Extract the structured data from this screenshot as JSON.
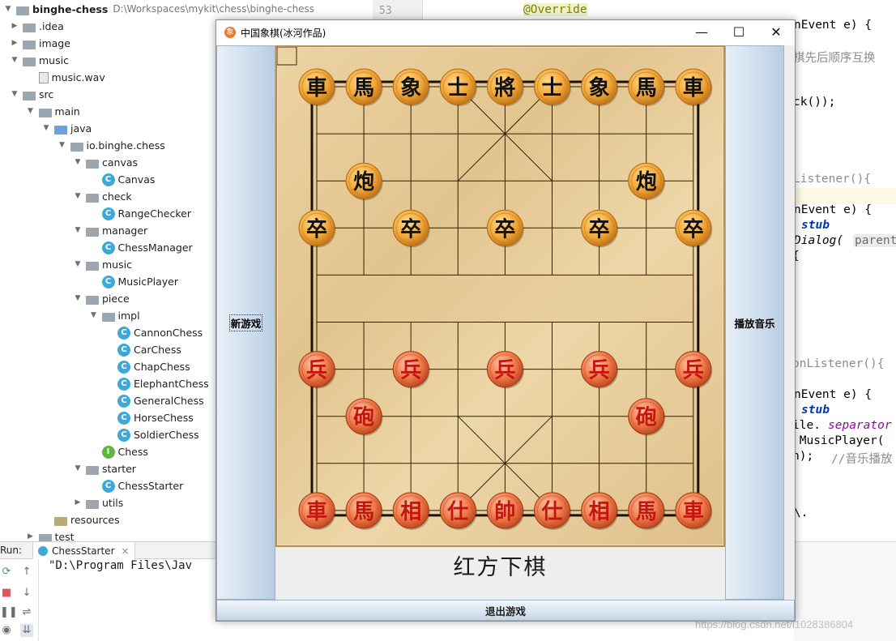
{
  "ide": {
    "project_root": {
      "name": "binghe-chess",
      "path": "D:\\Workspaces\\mykit\\chess\\binghe-chess"
    },
    "tree": [
      {
        "label": ".idea",
        "depth": 1,
        "kind": "folder",
        "arrow": "right"
      },
      {
        "label": "image",
        "depth": 1,
        "kind": "folder",
        "arrow": "right"
      },
      {
        "label": "music",
        "depth": 1,
        "kind": "folder",
        "arrow": "down"
      },
      {
        "label": "music.wav",
        "depth": 2,
        "kind": "file",
        "arrow": ""
      },
      {
        "label": "src",
        "depth": 1,
        "kind": "folder",
        "arrow": "down"
      },
      {
        "label": "main",
        "depth": 2,
        "kind": "folder",
        "arrow": "down"
      },
      {
        "label": "java",
        "depth": 3,
        "kind": "folder-blue",
        "arrow": "down"
      },
      {
        "label": "io.binghe.chess",
        "depth": 4,
        "kind": "folder",
        "arrow": "down"
      },
      {
        "label": "canvas",
        "depth": 5,
        "kind": "folder",
        "arrow": "down"
      },
      {
        "label": "Canvas",
        "depth": 6,
        "kind": "class",
        "arrow": ""
      },
      {
        "label": "check",
        "depth": 5,
        "kind": "folder",
        "arrow": "down"
      },
      {
        "label": "RangeChecker",
        "depth": 6,
        "kind": "class",
        "arrow": ""
      },
      {
        "label": "manager",
        "depth": 5,
        "kind": "folder",
        "arrow": "down"
      },
      {
        "label": "ChessManager",
        "depth": 6,
        "kind": "class",
        "arrow": ""
      },
      {
        "label": "music",
        "depth": 5,
        "kind": "folder",
        "arrow": "down"
      },
      {
        "label": "MusicPlayer",
        "depth": 6,
        "kind": "class",
        "arrow": ""
      },
      {
        "label": "piece",
        "depth": 5,
        "kind": "folder",
        "arrow": "down"
      },
      {
        "label": "impl",
        "depth": 6,
        "kind": "folder",
        "arrow": "down"
      },
      {
        "label": "CannonChess",
        "depth": 7,
        "kind": "class",
        "arrow": ""
      },
      {
        "label": "CarChess",
        "depth": 7,
        "kind": "class",
        "arrow": ""
      },
      {
        "label": "ChapChess",
        "depth": 7,
        "kind": "class",
        "arrow": ""
      },
      {
        "label": "ElephantChess",
        "depth": 7,
        "kind": "class",
        "arrow": ""
      },
      {
        "label": "GeneralChess",
        "depth": 7,
        "kind": "class",
        "arrow": ""
      },
      {
        "label": "HorseChess",
        "depth": 7,
        "kind": "class",
        "arrow": ""
      },
      {
        "label": "SoldierChess",
        "depth": 7,
        "kind": "class",
        "arrow": ""
      },
      {
        "label": "Chess",
        "depth": 6,
        "kind": "interface",
        "arrow": ""
      },
      {
        "label": "starter",
        "depth": 5,
        "kind": "folder",
        "arrow": "down"
      },
      {
        "label": "ChessStarter",
        "depth": 6,
        "kind": "class",
        "arrow": ""
      },
      {
        "label": "utils",
        "depth": 5,
        "kind": "folder",
        "arrow": "right"
      },
      {
        "label": "resources",
        "depth": 3,
        "kind": "folder-res",
        "arrow": ""
      },
      {
        "label": "test",
        "depth": 2,
        "kind": "folder",
        "arrow": "right"
      }
    ],
    "editor": {
      "line_number": "53",
      "annotation": "@Override",
      "lines": [
        {
          "text": "nEvent e) {"
        },
        {
          "text": "棋先后顺序互换"
        },
        {
          "text": "ck());"
        },
        {
          "text": "Listener(){"
        },
        {
          "text": "nEvent e) {"
        },
        {
          "text": "stub"
        },
        {
          "text": "Dialog("
        },
        {
          "text": "parent("
        },
        {
          "text": "{"
        },
        {
          "text": "onListener(){"
        },
        {
          "text": "nEvent e) {"
        },
        {
          "text": "stub"
        },
        {
          "text": "ile."
        },
        {
          "text": "separator"
        },
        {
          "text": " MusicPlayer("
        },
        {
          "text": "n);"
        },
        {
          "text": "//音乐播放"
        },
        {
          "text": "\\."
        }
      ]
    },
    "run": {
      "label": "Run:",
      "tab": "ChessStarter",
      "close_icon": "×",
      "console": "\"D:\\Program Files\\Jav"
    },
    "watermark": "https://blog.csdn.net/l1028386804"
  },
  "window": {
    "title": "中国象棋(冰河作品)",
    "controls": {
      "minimize": "—",
      "maximize": "☐",
      "close": "✕"
    },
    "buttons": {
      "new_game": "新游戏",
      "play_music": "播放音乐",
      "exit_game": "退出游戏"
    },
    "status": "红方下棋",
    "colors": {
      "black_piece_text": "#111111",
      "red_piece_text": "#c3160e",
      "piece_fill": "#f2a93a",
      "red_piece_fill": "#ee7a4a"
    }
  },
  "board": {
    "black_pieces": [
      {
        "label": "車",
        "col": 0,
        "row": 0
      },
      {
        "label": "馬",
        "col": 1,
        "row": 0
      },
      {
        "label": "象",
        "col": 2,
        "row": 0
      },
      {
        "label": "士",
        "col": 3,
        "row": 0
      },
      {
        "label": "將",
        "col": 4,
        "row": 0
      },
      {
        "label": "士",
        "col": 5,
        "row": 0
      },
      {
        "label": "象",
        "col": 6,
        "row": 0
      },
      {
        "label": "馬",
        "col": 7,
        "row": 0
      },
      {
        "label": "車",
        "col": 8,
        "row": 0
      },
      {
        "label": "炮",
        "col": 1,
        "row": 2
      },
      {
        "label": "炮",
        "col": 7,
        "row": 2
      },
      {
        "label": "卒",
        "col": 0,
        "row": 3
      },
      {
        "label": "卒",
        "col": 2,
        "row": 3
      },
      {
        "label": "卒",
        "col": 4,
        "row": 3
      },
      {
        "label": "卒",
        "col": 6,
        "row": 3
      },
      {
        "label": "卒",
        "col": 8,
        "row": 3
      }
    ],
    "red_pieces": [
      {
        "label": "兵",
        "col": 0,
        "row": 6
      },
      {
        "label": "兵",
        "col": 2,
        "row": 6
      },
      {
        "label": "兵",
        "col": 4,
        "row": 6
      },
      {
        "label": "兵",
        "col": 6,
        "row": 6
      },
      {
        "label": "兵",
        "col": 8,
        "row": 6
      },
      {
        "label": "砲",
        "col": 1,
        "row": 7
      },
      {
        "label": "砲",
        "col": 7,
        "row": 7
      },
      {
        "label": "車",
        "col": 0,
        "row": 9
      },
      {
        "label": "馬",
        "col": 1,
        "row": 9
      },
      {
        "label": "相",
        "col": 2,
        "row": 9
      },
      {
        "label": "仕",
        "col": 3,
        "row": 9
      },
      {
        "label": "帥",
        "col": 4,
        "row": 9
      },
      {
        "label": "仕",
        "col": 5,
        "row": 9
      },
      {
        "label": "相",
        "col": 6,
        "row": 9
      },
      {
        "label": "馬",
        "col": 7,
        "row": 9
      },
      {
        "label": "車",
        "col": 8,
        "row": 9
      }
    ]
  }
}
